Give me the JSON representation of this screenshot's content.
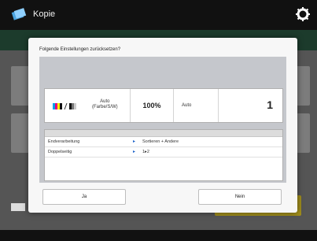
{
  "app": {
    "title": "Kopie",
    "icons": {
      "app": "copy-icon",
      "settings": "gear-icon"
    }
  },
  "dialog": {
    "title": "Folgende Einstellungen zurücksetzen?",
    "summary": {
      "color_mode_icon": "color-bw-icon",
      "color_mode_text": "Auto\n(Farbe/S/W)",
      "zoom": "100%",
      "paper": "Auto",
      "copies": "1"
    },
    "settings": [
      {
        "label": "Endverarbeitung",
        "value": "Sortieren + Andere"
      },
      {
        "label": "Doppelseitig",
        "value": "1▸2"
      }
    ],
    "yes_label": "Ja",
    "no_label": "Nein"
  },
  "colors": {
    "accent": "#1d63c8",
    "yellow_button": "#a08d1c",
    "topbar": "#111111"
  }
}
